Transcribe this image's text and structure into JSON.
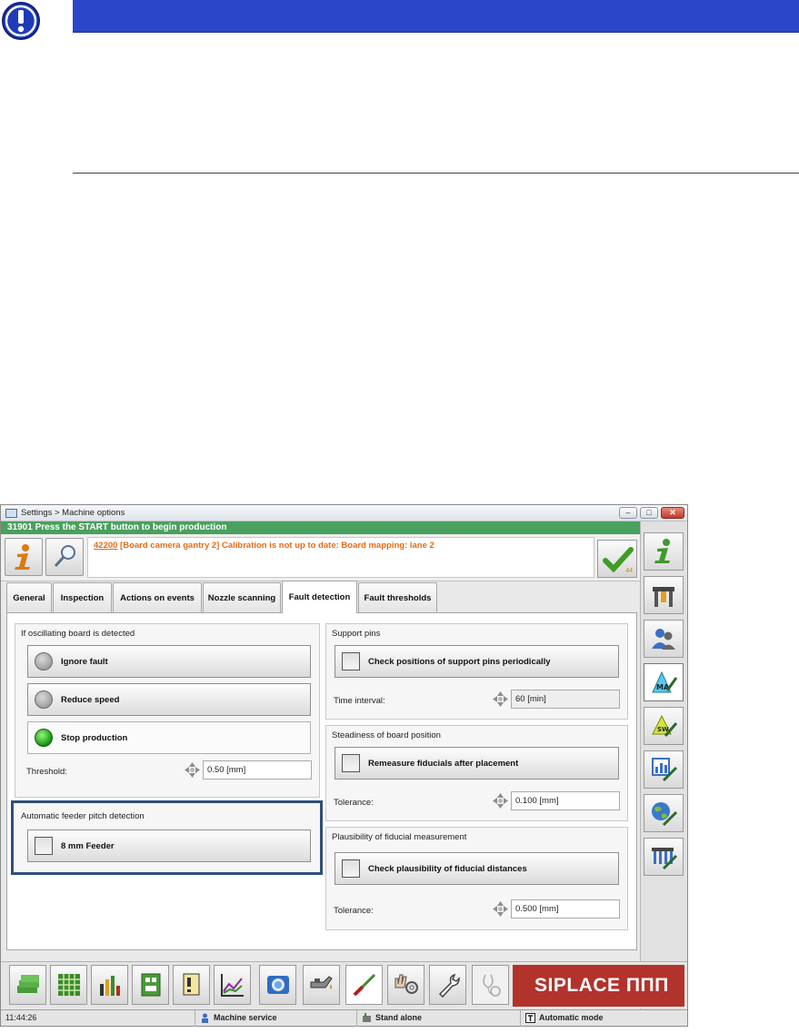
{
  "window": {
    "title": "Settings > Machine options",
    "status_message": "31901 Press the START button to begin production",
    "controls": [
      "–",
      "□",
      "✕"
    ]
  },
  "message": {
    "code": "42200",
    "text": " [Board camera gantry 2] Calibration is not up to date: Board mapping: lane 2",
    "ack_count": "44"
  },
  "tabs": [
    {
      "label": "General"
    },
    {
      "label": "Inspection"
    },
    {
      "label": "Actions on events"
    },
    {
      "label": "Nozzle scanning"
    },
    {
      "label": "Fault detection",
      "active": true
    },
    {
      "label": "Fault thresholds"
    }
  ],
  "oscillating": {
    "heading": "If oscillating board is detected",
    "options": [
      "Ignore fault",
      "Reduce speed",
      "Stop production"
    ],
    "selected": "Stop production",
    "threshold_label": "Threshold:",
    "threshold_value": "0.50 [mm]"
  },
  "feeder": {
    "heading": "Automatic feeder pitch detection",
    "option": "8 mm Feeder"
  },
  "support_pins": {
    "heading": "Support pins",
    "option": "Check positions of support pins periodically",
    "interval_label": "Time interval:",
    "interval_value": "60 [min]"
  },
  "steadiness": {
    "heading": "Steadiness of board position",
    "option": "Remeasure fiducials after placement",
    "tolerance_label": "Tolerance:",
    "tolerance_value": "0.100 [mm]"
  },
  "plausibility": {
    "heading": "Plausibility of fiducial measurement",
    "option": "Check plausibility of fiducial distances",
    "tolerance_label": "Tolerance:",
    "tolerance_value": "0.500 [mm]"
  },
  "brand": "SIPLACE ΠΠΠ",
  "statusbar": {
    "time": "11:44:26",
    "service": "Machine service",
    "mode_line": "Stand alone",
    "mode": "Automatic mode"
  },
  "colors": {
    "doc_bar": "#2b46c8",
    "status_green": "#4aa05e",
    "message_orange": "#e46b16",
    "brand_red": "#b2332b",
    "highlight_border": "#2e4f7a"
  },
  "icons": {
    "warning": "exclamation-icon",
    "info": "info-icon",
    "search": "magnifier-icon",
    "acknowledge": "checkmark-icon"
  }
}
